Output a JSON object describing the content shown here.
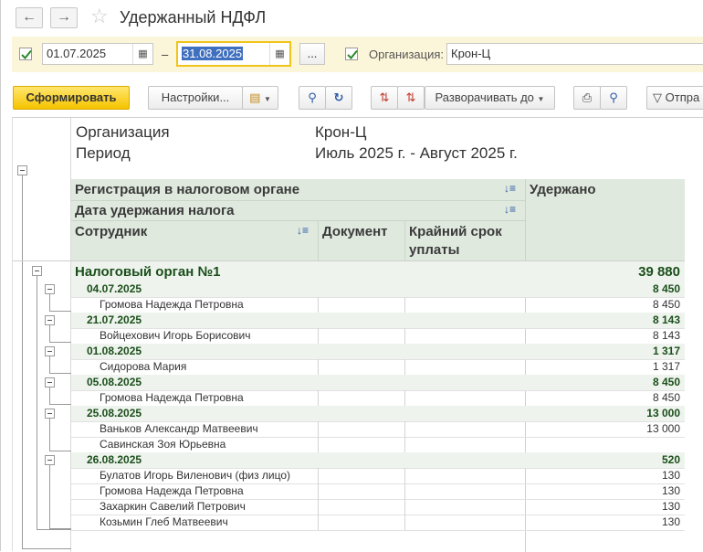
{
  "window": {
    "title": "Удержанный НДФЛ"
  },
  "params": {
    "date_from": "01.07.2025",
    "date_to": "31.08.2025",
    "dash": "–",
    "ellipsis": "...",
    "org_label": "Организация:",
    "org_value": "Крон-Ц"
  },
  "toolbar": {
    "generate": "Сформировать",
    "settings": "Настройки...",
    "expand": "Разворачивать до",
    "send": "Отпра"
  },
  "report": {
    "org_caption": "Организация",
    "org_value": "Крон-Ц",
    "period_caption": "Период",
    "period_value": "Июль 2025 г. - Август 2025 г.",
    "col_registration": "Регистрация в налоговом органе",
    "col_date": "Дата удержания налога",
    "col_employee": "Сотрудник",
    "col_document": "Документ",
    "col_deadline_1": "Крайний срок",
    "col_deadline_2": "уплаты",
    "col_withheld": "Удержано",
    "group_title": "Налоговый орган №1",
    "group_total": "39 880",
    "dates": [
      {
        "date": "04.07.2025",
        "total": "8 450",
        "rows": [
          {
            "name": "Громова Надежда Петровна",
            "amount": "8 450"
          }
        ]
      },
      {
        "date": "21.07.2025",
        "total": "8 143",
        "rows": [
          {
            "name": "Войцехович Игорь Борисович",
            "amount": "8 143"
          }
        ]
      },
      {
        "date": "01.08.2025",
        "total": "1 317",
        "rows": [
          {
            "name": "Сидорова Мария",
            "amount": "1 317"
          }
        ]
      },
      {
        "date": "05.08.2025",
        "total": "8 450",
        "rows": [
          {
            "name": "Громова Надежда Петровна",
            "amount": "8 450"
          }
        ]
      },
      {
        "date": "25.08.2025",
        "total": "13 000",
        "rows": [
          {
            "name": "Ваньков Александр Матвеевич",
            "amount": "13 000"
          },
          {
            "name": "Савинская Зоя Юрьевна",
            "amount": ""
          }
        ]
      },
      {
        "date": "26.08.2025",
        "total": "520",
        "rows": [
          {
            "name": "Булатов Игорь Виленович (физ лицо)",
            "amount": "130"
          },
          {
            "name": "Громова Надежда Петровна",
            "amount": "130"
          },
          {
            "name": "Захаркин Савелий Петрович",
            "amount": "130"
          },
          {
            "name": "Козьмин Глеб Матвеевич",
            "amount": "130"
          }
        ]
      }
    ]
  }
}
